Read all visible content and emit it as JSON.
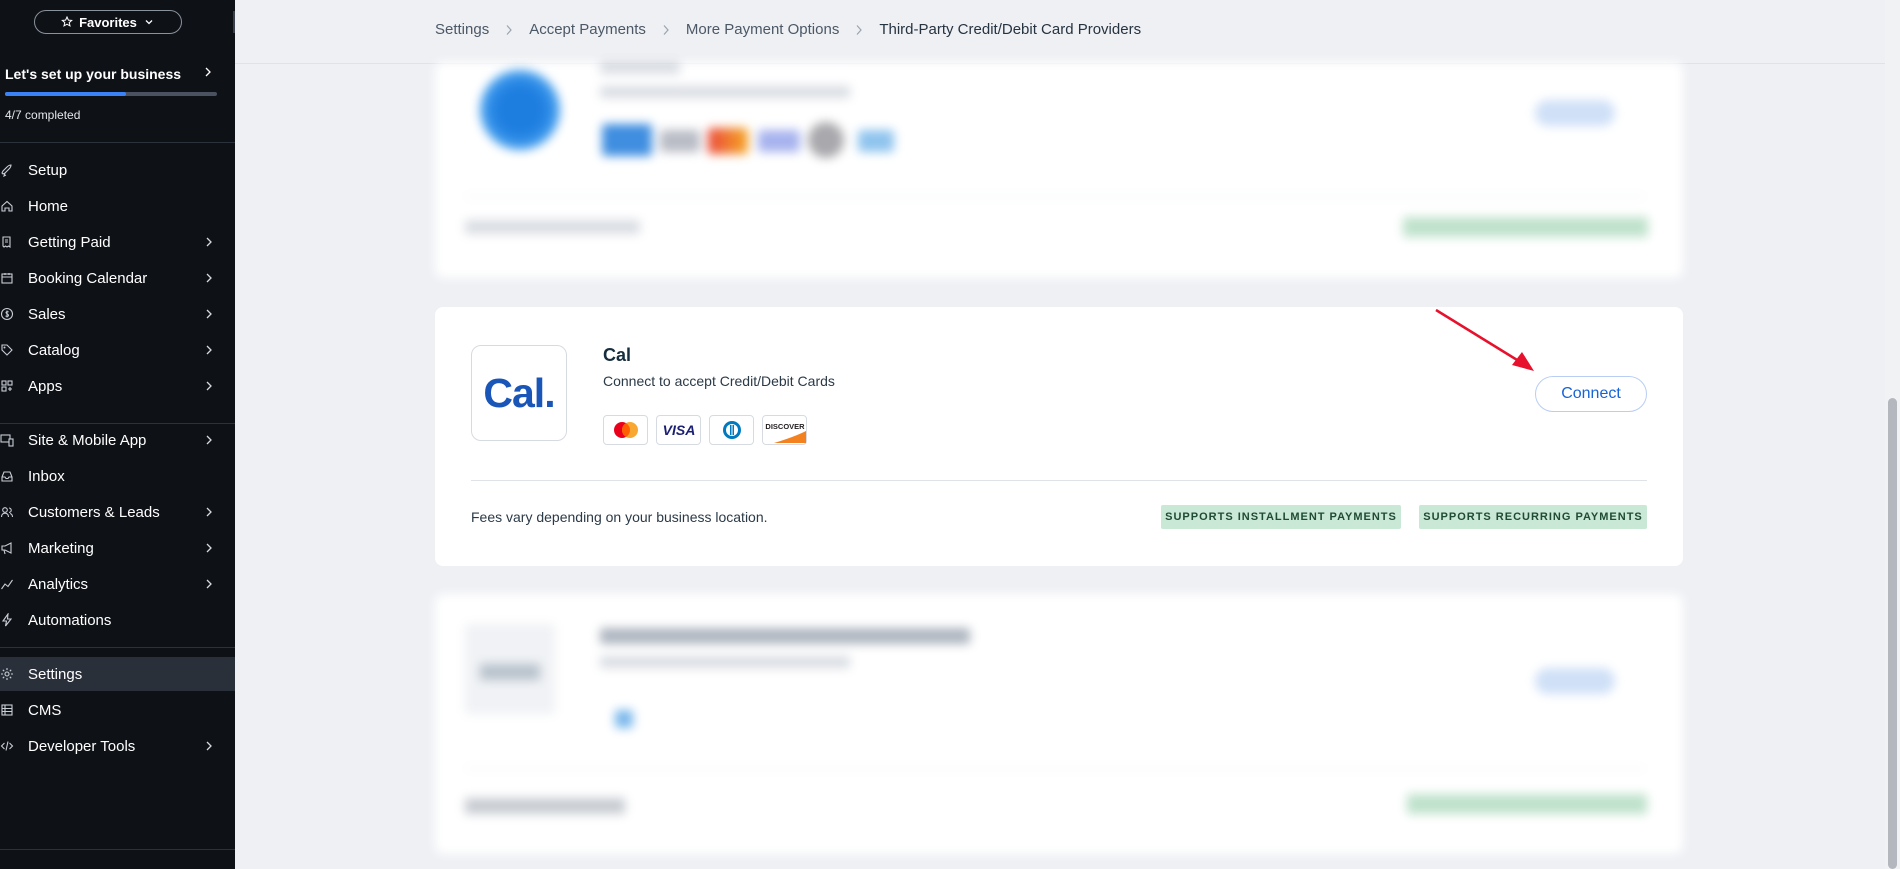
{
  "sidebar": {
    "favorites_label": "Favorites",
    "setup": {
      "title": "Let's set up your business",
      "progress_fraction": 0.57,
      "count": "4/7 completed"
    },
    "items": [
      {
        "label": "Setup",
        "icon": "rocket-icon",
        "chevron": false
      },
      {
        "label": "Home",
        "icon": "home-icon",
        "chevron": false
      },
      {
        "label": "Getting Paid",
        "icon": "receipt-icon",
        "chevron": true
      },
      {
        "label": "Booking Calendar",
        "icon": "calendar-icon",
        "chevron": true
      },
      {
        "label": "Sales",
        "icon": "dollar-icon",
        "chevron": true
      },
      {
        "label": "Catalog",
        "icon": "tag-icon",
        "chevron": true
      },
      {
        "label": "Apps",
        "icon": "apps-icon",
        "chevron": true
      },
      {
        "label": "Site & Mobile App",
        "icon": "devices-icon",
        "chevron": true
      },
      {
        "label": "Inbox",
        "icon": "inbox-icon",
        "chevron": false
      },
      {
        "label": "Customers & Leads",
        "icon": "people-icon",
        "chevron": true
      },
      {
        "label": "Marketing",
        "icon": "megaphone-icon",
        "chevron": true
      },
      {
        "label": "Analytics",
        "icon": "chart-line-icon",
        "chevron": true
      },
      {
        "label": "Automations",
        "icon": "bolt-icon",
        "chevron": false
      },
      {
        "label": "Settings",
        "icon": "gear-icon",
        "chevron": false,
        "active": true
      },
      {
        "label": "CMS",
        "icon": "table-icon",
        "chevron": false
      },
      {
        "label": "Developer Tools",
        "icon": "code-icon",
        "chevron": true
      }
    ]
  },
  "breadcrumb": {
    "items": [
      "Settings",
      "Accept Payments",
      "More Payment Options"
    ],
    "current": "Third-Party Credit/Debit Card Providers"
  },
  "provider": {
    "logo_text": "Cal.",
    "name": "Cal",
    "description": "Connect to accept Credit/Debit Cards",
    "cards": [
      "mastercard-icon",
      "visa-icon",
      "diners-icon",
      "discover-icon"
    ],
    "connect_label": "Connect",
    "fees": "Fees vary depending on your business location.",
    "badges": [
      "SUPPORTS INSTALLMENT PAYMENTS",
      "SUPPORTS RECURRING PAYMENTS"
    ]
  },
  "colors": {
    "sidebar_bg": "#0e1116",
    "accent": "#1664d6",
    "badge_bg": "#c9e8d5",
    "annotation_arrow": "#e8112d"
  }
}
